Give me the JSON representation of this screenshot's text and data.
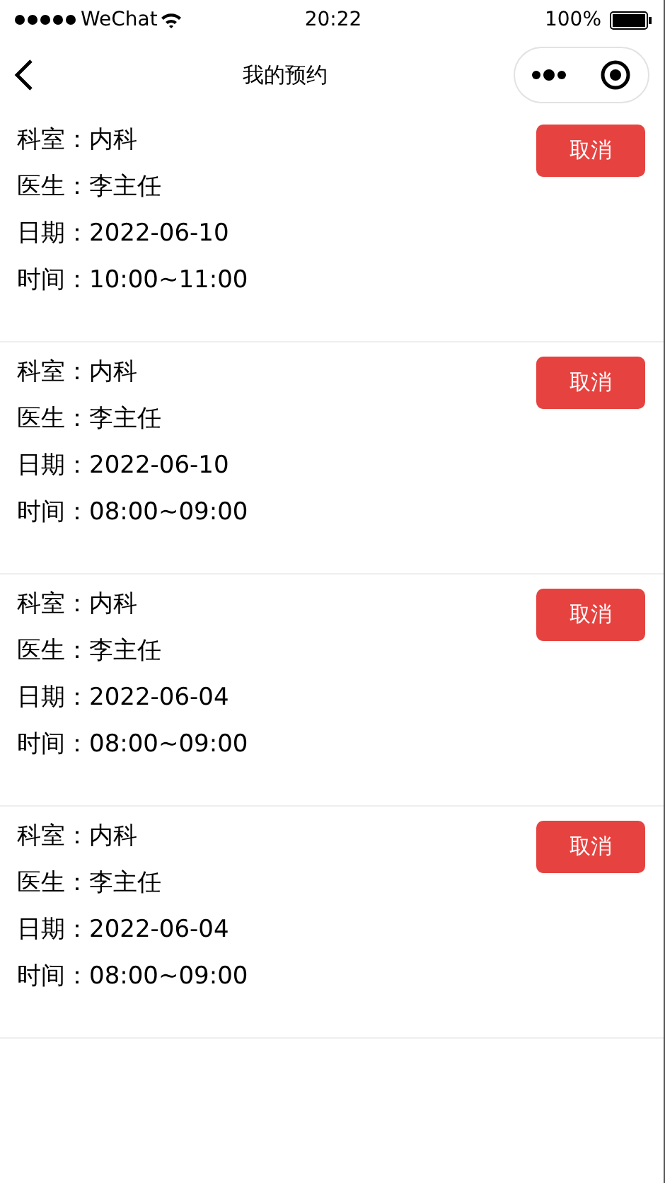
{
  "status_bar": {
    "carrier": "WeChat",
    "time": "20:22",
    "battery": "100%"
  },
  "nav_bar": {
    "title": "我的预约"
  },
  "appointments": [
    {
      "lines": [
        "科室：内科",
        "医生：李主任",
        "日期：2022-06-10",
        "时间：10:00~11:00"
      ],
      "button": "取消"
    },
    {
      "lines": [
        "科室：内科",
        "医生：李主任",
        "日期：2022-06-10",
        "时间：08:00~09:00"
      ],
      "button": "取消"
    },
    {
      "lines": [
        "科室：内科",
        "医生：李主任",
        "日期：2022-06-04",
        "时间：08:00~09:00"
      ],
      "button": "取消"
    },
    {
      "lines": [
        "科室：内科",
        "医生：李主任",
        "日期：2022-06-04",
        "时间：08:00~09:00"
      ],
      "button": "取消"
    }
  ]
}
